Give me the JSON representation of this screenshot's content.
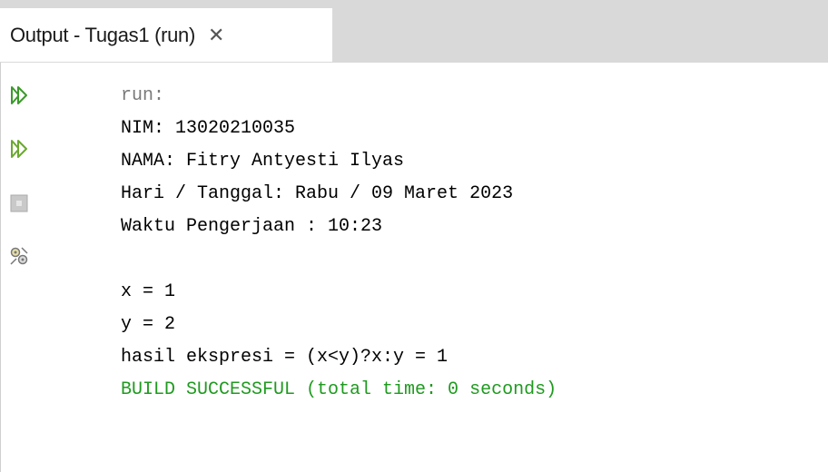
{
  "tab": {
    "title": "Output - Tugas1 (run)",
    "close_glyph": "✕"
  },
  "toolbar": {
    "buttons": [
      {
        "name": "rerun-icon",
        "color": "#3a9a2a"
      },
      {
        "name": "rerun-with-options-icon",
        "color": "#3a9a2a"
      },
      {
        "name": "stop-icon",
        "color": "#b8b8b8"
      },
      {
        "name": "settings-icon",
        "color": "#777777"
      }
    ]
  },
  "output": {
    "lines": [
      {
        "text": "run:",
        "kind": "gray"
      },
      {
        "text": "NIM: 13020210035",
        "kind": "normal"
      },
      {
        "text": "NAMA: Fitry Antyesti Ilyas",
        "kind": "normal"
      },
      {
        "text": "Hari / Tanggal: Rabu / 09 Maret 2023",
        "kind": "normal"
      },
      {
        "text": "Waktu Pengerjaan : 10:23",
        "kind": "normal"
      },
      {
        "text": "",
        "kind": "blank"
      },
      {
        "text": "x = 1",
        "kind": "normal"
      },
      {
        "text": "y = 2",
        "kind": "normal"
      },
      {
        "text": "hasil ekspresi = (x<y)?x:y = 1",
        "kind": "normal"
      },
      {
        "text": "BUILD SUCCESSFUL (total time: 0 seconds)",
        "kind": "green"
      }
    ]
  },
  "colors": {
    "success": "#1f9a1f",
    "muted": "#7a7a7a",
    "tabbar": "#d9d9d9"
  }
}
